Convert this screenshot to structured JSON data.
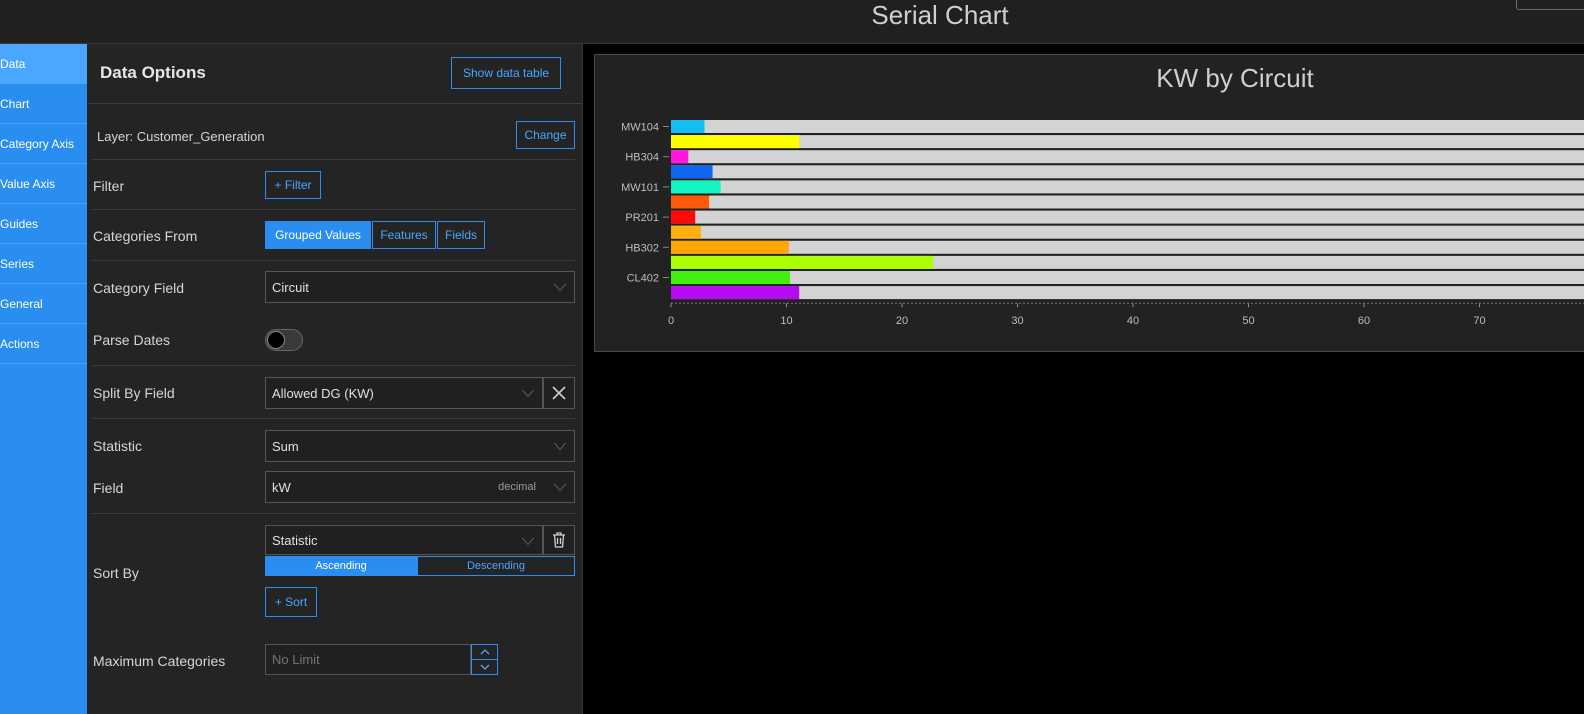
{
  "header": {
    "title": "Serial Chart"
  },
  "nav": {
    "items": [
      {
        "label": "Data"
      },
      {
        "label": "Chart"
      },
      {
        "label": "Category Axis"
      },
      {
        "label": "Value Axis"
      },
      {
        "label": "Guides"
      },
      {
        "label": "Series"
      },
      {
        "label": "General"
      },
      {
        "label": "Actions"
      }
    ]
  },
  "panel": {
    "title": "Data Options",
    "show_table_label": "Show data table",
    "layer_label": "Layer: Customer_Generation",
    "change_label": "Change",
    "filter_label": "Filter",
    "filter_button": "+ Filter",
    "categories_from_label": "Categories From",
    "categories_options": [
      "Grouped Values",
      "Features",
      "Fields"
    ],
    "category_field_label": "Category Field",
    "category_field_value": "Circuit",
    "parse_dates_label": "Parse Dates",
    "split_by_label": "Split By Field",
    "split_by_value": "Allowed DG (KW)",
    "statistic_label": "Statistic",
    "statistic_value": "Sum",
    "field_label": "Field",
    "field_value": "kW",
    "field_type": "decimal",
    "sort_by_label": "Sort By",
    "sort_value": "Statistic",
    "ascending_label": "Ascending",
    "descending_label": "Descending",
    "add_sort_label": "+ Sort",
    "max_categories_label": "Maximum Categories",
    "max_categories_placeholder": "No Limit"
  },
  "colors": {
    "accent": "#2a8ef0",
    "nav_bg": "#2a8ef0",
    "panel_bg": "#242424"
  },
  "chart_data": {
    "type": "bar",
    "orientation": "horizontal",
    "title": "KW by Circuit",
    "categories": [
      "MW104",
      "HB304",
      "MW101",
      "PR201",
      "HB302",
      "CL402"
    ],
    "xlim": [
      0,
      80
    ],
    "x_ticks": [
      0,
      10,
      20,
      30,
      40,
      50,
      60,
      70
    ],
    "track_color": "#d3d3d3",
    "bars": [
      {
        "category": "MW104",
        "value": 2.9,
        "color": "#12bff0"
      },
      {
        "category": "MW104",
        "value": 11.1,
        "color": "#ffff00"
      },
      {
        "category": "HB304",
        "value": 1.5,
        "color": "#ff17e0"
      },
      {
        "category": "HB304",
        "value": 3.6,
        "color": "#1066f0"
      },
      {
        "category": "MW101",
        "value": 4.3,
        "color": "#12f5c0"
      },
      {
        "category": "MW101",
        "value": 3.3,
        "color": "#ff5a0a"
      },
      {
        "category": "PR201",
        "value": 2.1,
        "color": "#ff0a0a"
      },
      {
        "category": "PR201",
        "value": 2.6,
        "color": "#ffaf10"
      },
      {
        "category": "HB302",
        "value": 10.2,
        "color": "#ffa505"
      },
      {
        "category": "HB302",
        "value": 22.7,
        "color": "#aaff00"
      },
      {
        "category": "CL402",
        "value": 10.3,
        "color": "#44ee10"
      },
      {
        "category": "CL402",
        "value": 11.1,
        "color": "#b60af0"
      }
    ]
  }
}
